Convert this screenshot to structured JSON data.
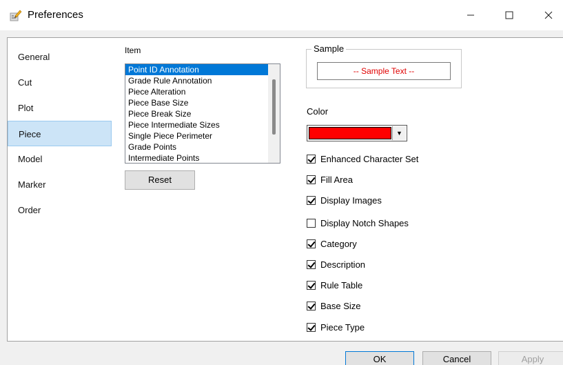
{
  "window": {
    "title": "Preferences",
    "icon": "preferences-pencil-icon"
  },
  "sidebar": {
    "items": [
      {
        "label": "General",
        "selected": false
      },
      {
        "label": "Cut",
        "selected": false
      },
      {
        "label": "Plot",
        "selected": false
      },
      {
        "label": "Piece",
        "selected": true
      },
      {
        "label": "Model",
        "selected": false
      },
      {
        "label": "Marker",
        "selected": false
      },
      {
        "label": "Order",
        "selected": false
      }
    ]
  },
  "item_list": {
    "label": "Item",
    "items": [
      "Point ID Annotation",
      "Grade Rule Annotation",
      "Piece Alteration",
      "Piece Base Size",
      "Piece Break Size",
      "Piece Intermediate Sizes",
      "Single Piece Perimeter",
      "Grade Points",
      "Intermediate Points"
    ],
    "selected_index": 0,
    "reset_label": "Reset"
  },
  "sample": {
    "legend": "Sample",
    "text": "-- Sample Text --",
    "text_color": "#e00000"
  },
  "color": {
    "label": "Color",
    "value": "#ff0000"
  },
  "options": [
    {
      "label": "Enhanced Character Set",
      "checked": true
    },
    {
      "label": "Fill Area",
      "checked": true
    },
    {
      "label": "Display Images",
      "checked": true
    },
    {
      "label": "Display Notch Shapes",
      "checked": false
    },
    {
      "label": "Category",
      "checked": true
    },
    {
      "label": "Description",
      "checked": true
    },
    {
      "label": "Rule Table",
      "checked": true
    },
    {
      "label": "Base Size",
      "checked": true
    },
    {
      "label": "Piece Type",
      "checked": true
    }
  ],
  "footer": {
    "ok_label": "OK",
    "cancel_label": "Cancel",
    "apply_label": "Apply",
    "apply_enabled": false
  }
}
